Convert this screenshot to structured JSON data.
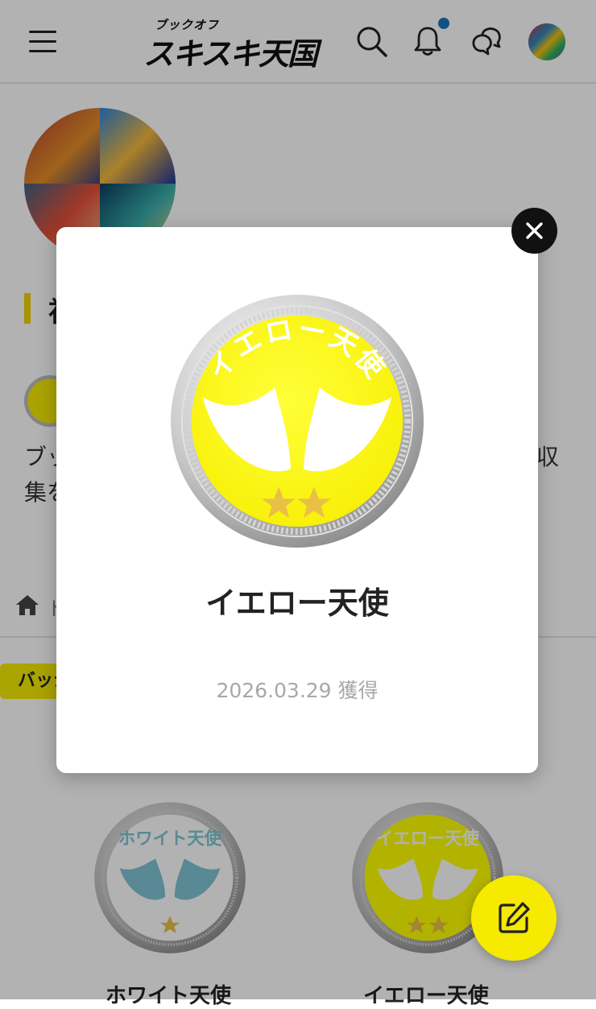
{
  "header": {
    "logo_ruby": "ブックオフ",
    "logo_main": "スキスキ天国",
    "icons": [
      "menu-icon",
      "search-icon",
      "bell-icon",
      "chat-icon"
    ],
    "notification_color": "#1a73c2"
  },
  "profile": {
    "section_title": "初",
    "description_start": "ブッ",
    "description_line2": "集を",
    "description_end": "収"
  },
  "breadcrumb": {
    "home_text": "ト"
  },
  "tag": {
    "label": "バッジ"
  },
  "badges": [
    {
      "name": "ホワイト天使",
      "stars": 1,
      "theme": "white"
    },
    {
      "name": "イエロー天使",
      "stars": 2,
      "theme": "yellow"
    }
  ],
  "modal": {
    "badge_name": "イエロー天使",
    "badge_arc_text": "イエロー天使",
    "stars": 2,
    "acquired_date": "2026.03.29 獲得"
  },
  "colors": {
    "accent_yellow": "#f5ea00",
    "badge_yellow": "#ffff00",
    "white_badge_wings": "#7fc4d4",
    "star_gold": "#e9c046"
  }
}
